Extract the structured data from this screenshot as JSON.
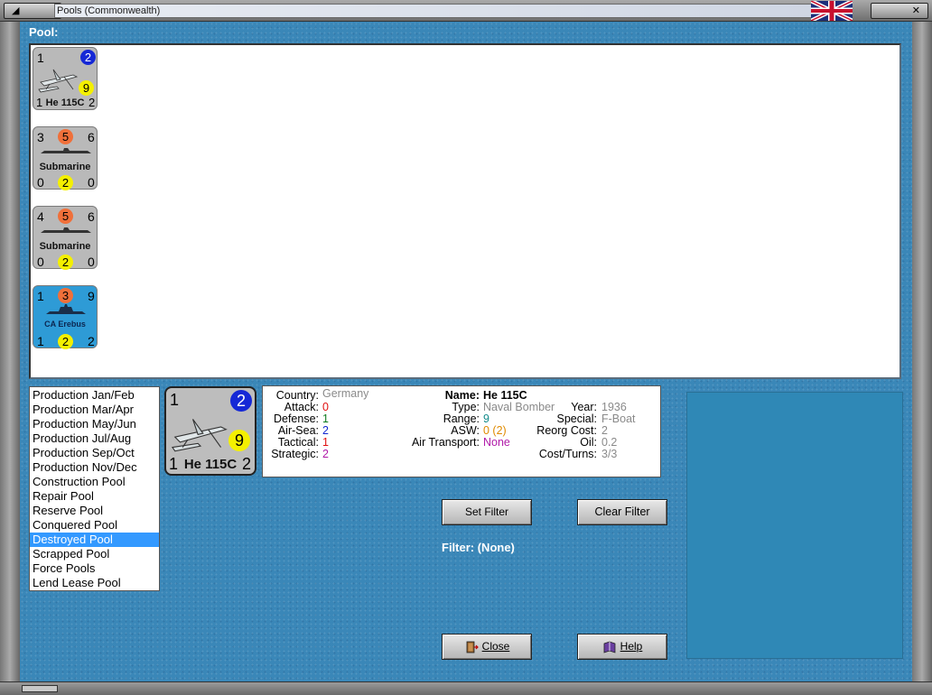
{
  "window": {
    "title": "Pools (Commonwealth)",
    "flag_icon": "union-jack-flag-icon"
  },
  "pool_label": "Pool:",
  "pool_counters": [
    {
      "type": "aircraft",
      "top_left": "1",
      "top_right": "2",
      "middle_right": "9",
      "bottom_left": "1",
      "name": "He 115C",
      "bottom_right": "2",
      "bg": "#b9b9b9"
    },
    {
      "type": "ship",
      "top_left": "3",
      "top_mid": "5",
      "top_right": "6",
      "name": "Submarine",
      "bottom_left": "0",
      "bottom_mid": "2",
      "bottom_right": "0",
      "bg": "#b9b9b9"
    },
    {
      "type": "ship",
      "top_left": "4",
      "top_mid": "5",
      "top_right": "6",
      "name": "Submarine",
      "bottom_left": "0",
      "bottom_mid": "2",
      "bottom_right": "0",
      "bg": "#b9b9b9"
    },
    {
      "type": "ship",
      "top_left": "1",
      "top_mid": "3",
      "top_right": "9",
      "name": "CA Erebus",
      "bottom_left": "1",
      "bottom_mid": "2",
      "bottom_right": "2",
      "bg": "#2e9bd6"
    }
  ],
  "pool_list": [
    "Production Jan/Feb",
    "Production Mar/Apr",
    "Production May/Jun",
    "Production Jul/Aug",
    "Production Sep/Oct",
    "Production Nov/Dec",
    "Construction Pool",
    "Repair Pool",
    "Reserve Pool",
    "Conquered Pool",
    "Destroyed Pool",
    "Scrapped Pool",
    "Force Pools",
    "Lend Lease Pool"
  ],
  "pool_list_selected": "Destroyed Pool",
  "selected_counter": {
    "top_left": "1",
    "top_right": "2",
    "middle_right": "9",
    "bottom_left": "1",
    "name": "He 115C",
    "bottom_right": "2"
  },
  "info": {
    "country_label": "Country:",
    "country": "Germany",
    "attack_label": "Attack:",
    "attack": "0",
    "defense_label": "Defense:",
    "defense": "1",
    "airsea_label": "Air-Sea:",
    "airsea": "2",
    "tactical_label": "Tactical:",
    "tactical": "1",
    "strategic_label": "Strategic:",
    "strategic": "2",
    "name_label": "Name:",
    "name": "He 115C",
    "type_label": "Type:",
    "type": "Naval Bomber",
    "range_label": "Range:",
    "range": "9",
    "asw_label": "ASW:",
    "asw": "0 (2)",
    "air_transport_label": "Air Transport:",
    "air_transport": "None",
    "year_label": "Year:",
    "year": "1936",
    "special_label": "Special:",
    "special": "F-Boat",
    "reorg_label": "Reorg Cost:",
    "reorg": "2",
    "oil_label": "Oil:",
    "oil": "0.2",
    "cost_label": "Cost/Turns:",
    "cost": "3/3"
  },
  "buttons": {
    "set_filter": "Set Filter",
    "clear_filter": "Clear Filter",
    "close": "Close",
    "help": "Help"
  },
  "filter_text": "Filter: (None)"
}
